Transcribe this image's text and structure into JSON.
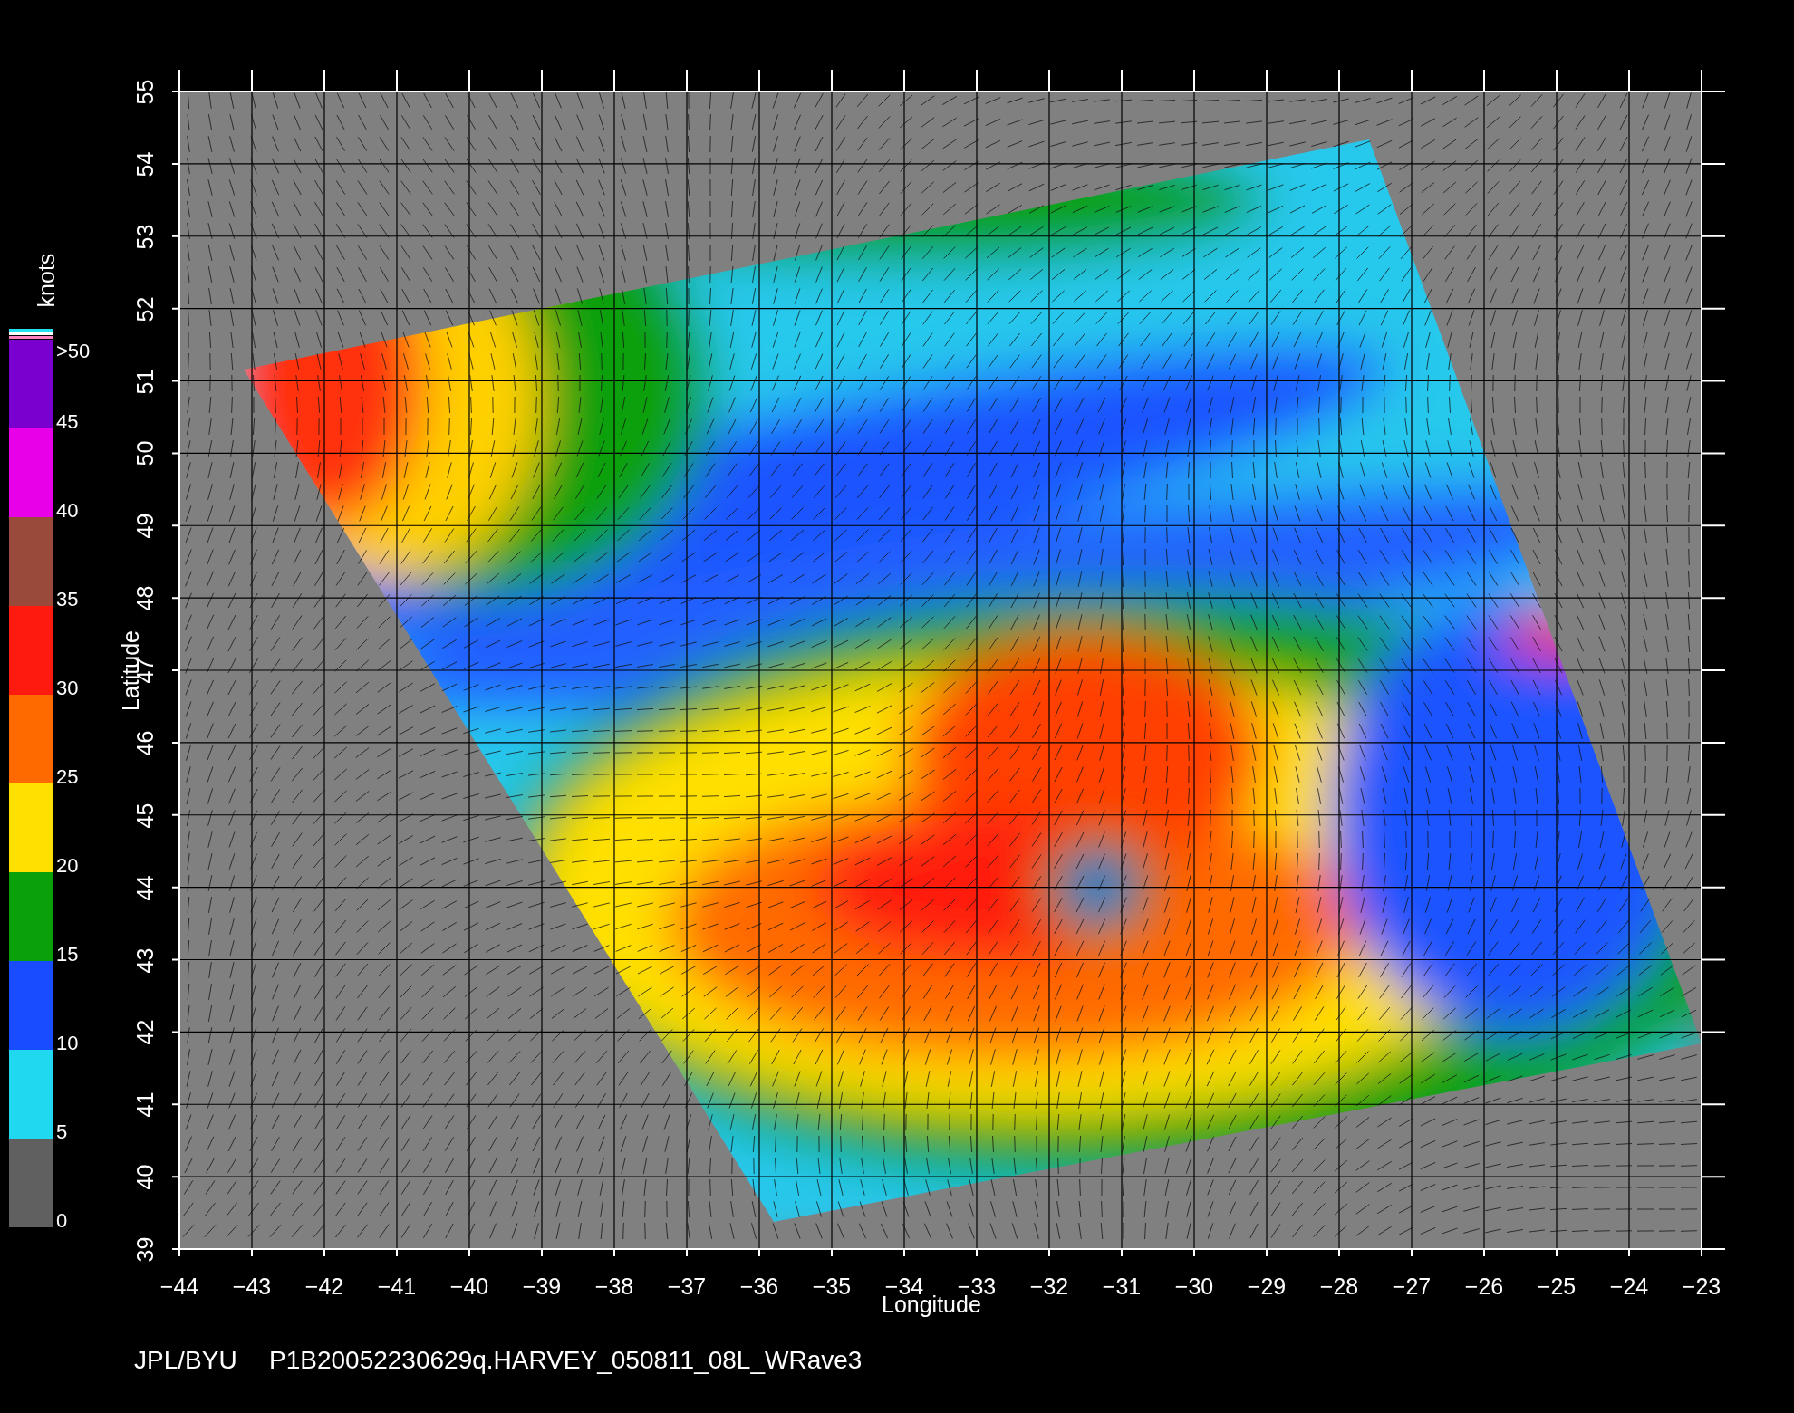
{
  "plot": {
    "x_ticks": [
      "−44",
      "−43",
      "−42",
      "−41",
      "−40",
      "−39",
      "−38",
      "−37",
      "−36",
      "−35",
      "−34",
      "−33",
      "−32",
      "−31",
      "−30",
      "−29",
      "−28",
      "−27",
      "−26",
      "−25",
      "−24",
      "−23"
    ],
    "y_ticks": [
      "39",
      "40",
      "41",
      "42",
      "43",
      "44",
      "45",
      "46",
      "47",
      "48",
      "49",
      "50",
      "51",
      "52",
      "53",
      "54",
      "55"
    ],
    "xlabel": "Longitude",
    "ylabel": "Latitude"
  },
  "colorbar": {
    "unit": "knots",
    "segments": [
      {
        "color": "#7a00d0"
      },
      {
        "color": "#e800e8"
      },
      {
        "color": "#9a4a3a"
      },
      {
        "color": "#ff1a10"
      },
      {
        "color": "#ff6a00"
      },
      {
        "color": "#ffe000"
      },
      {
        "color": "#0aa00a"
      },
      {
        "color": "#1a4cff"
      },
      {
        "color": "#20d8f0"
      },
      {
        "color": "#606060"
      }
    ],
    "labels": [
      ">50",
      "45",
      "40",
      "35",
      "30",
      "25",
      "20",
      "15",
      "10",
      "5",
      "0"
    ]
  },
  "footer": [
    "JPL/BYU",
    "P1B20052230629q.HARVEY_050811_08L_WRave3"
  ]
}
